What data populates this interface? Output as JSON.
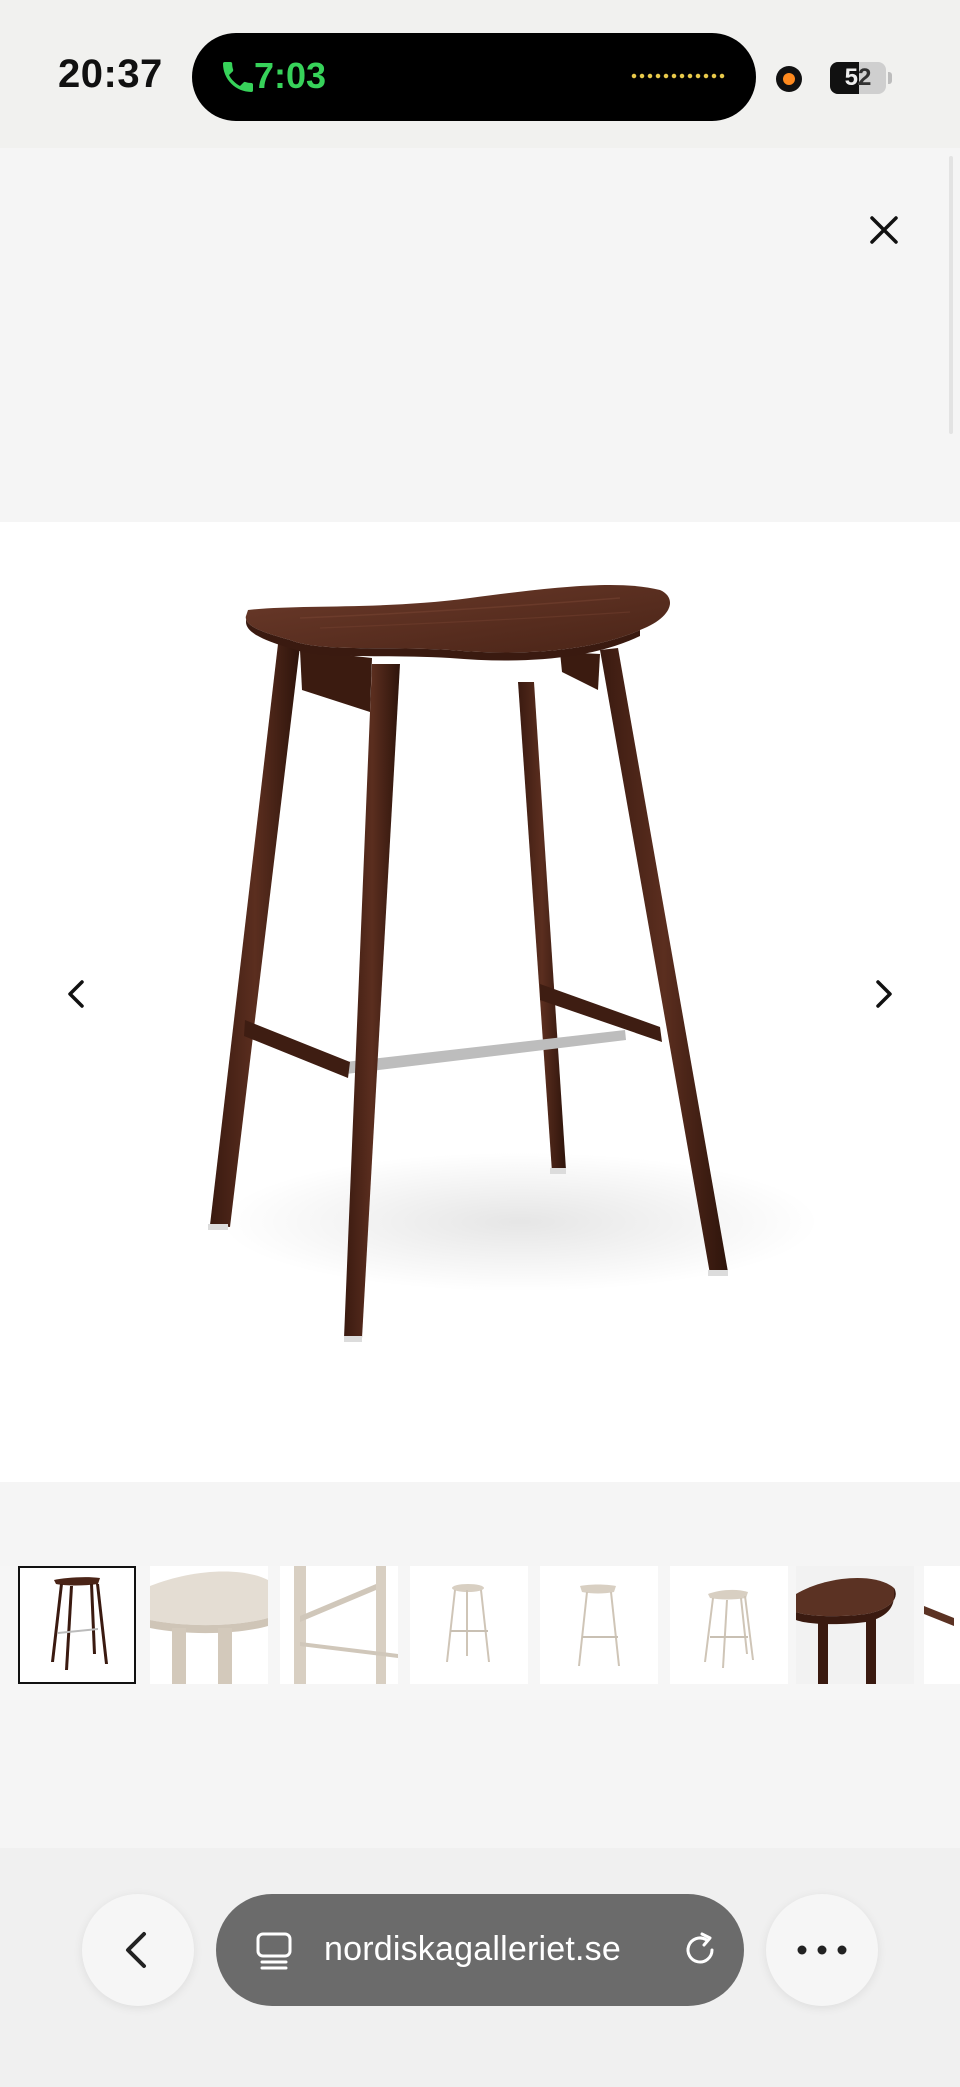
{
  "status_bar": {
    "time": "20:37",
    "call_time": "7:03",
    "battery_level": "52",
    "battery_fraction": 0.52
  },
  "viewer": {
    "close_icon": "close-icon",
    "prev_icon": "chevron-left-icon",
    "next_icon": "chevron-right-icon",
    "product_colors": {
      "walnut": "#4a2417",
      "ash": "#d8cfc2",
      "steel": "#b8b8b8"
    }
  },
  "thumbnails": [
    {
      "variant": "walnut-stool",
      "active": true
    },
    {
      "variant": "ash-seat-closeup",
      "active": false
    },
    {
      "variant": "ash-leg-detail",
      "active": false
    },
    {
      "variant": "ash-stool-front",
      "active": false
    },
    {
      "variant": "ash-stool-side",
      "active": false
    },
    {
      "variant": "ash-stool-angle",
      "active": false
    },
    {
      "variant": "walnut-seat-closeup",
      "active": false
    },
    {
      "variant": "walnut-edge-detail",
      "active": false
    }
  ],
  "browser": {
    "url": "nordiskagalleriet.se",
    "back_icon": "chevron-left-icon",
    "tabs_icon": "tabs-icon",
    "reload_icon": "reload-icon",
    "more_icon": "more-icon"
  }
}
